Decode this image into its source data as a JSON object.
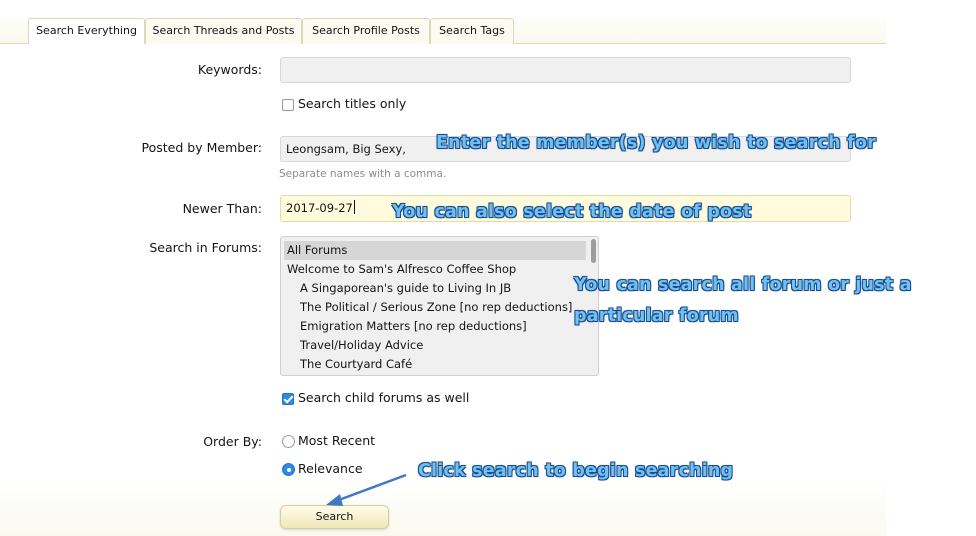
{
  "tabs": [
    {
      "label": "Search Everything",
      "active": true
    },
    {
      "label": "Search Threads and Posts",
      "active": false
    },
    {
      "label": "Search Profile Posts",
      "active": false
    },
    {
      "label": "Search Tags",
      "active": false
    }
  ],
  "form": {
    "keywords": {
      "label": "Keywords:",
      "value": ""
    },
    "titles_only": {
      "label": "Search titles only",
      "checked": false
    },
    "posted_by": {
      "label": "Posted by Member:",
      "value": "Leongsam, Big Sexy,",
      "hint": "Separate names with a comma."
    },
    "newer_than": {
      "label": "Newer Than:",
      "value": "2017-09-27"
    },
    "forums": {
      "label": "Search in Forums:",
      "options": [
        "All Forums",
        "Welcome to Sam's Alfresco Coffee Shop",
        "A Singaporean's guide to Living In JB",
        "The Political / Serious Zone [no rep deductions]",
        "Emigration Matters [no rep deductions]",
        "Travel/Holiday Advice",
        "The Courtyard Café"
      ],
      "selected": "All Forums"
    },
    "child_forums": {
      "label": "Search child forums as well",
      "checked": true
    },
    "order_by": {
      "label": "Order By:",
      "options": [
        "Most Recent",
        "Relevance"
      ],
      "selected": "Relevance"
    },
    "submit_label": "Search"
  },
  "annotations": {
    "member": "Enter the member(s) you wish to search for",
    "date": "You can also select the date of post",
    "forum_line1": "You can search all forum or just a",
    "forum_line2": "particular forum",
    "search": "Click search to begin searching"
  },
  "colors": {
    "accent": "#2f8ae0",
    "annotation_fill": "#6ec2f2",
    "annotation_outline": "#1c4a8c",
    "date_field": "#fffbdc"
  }
}
